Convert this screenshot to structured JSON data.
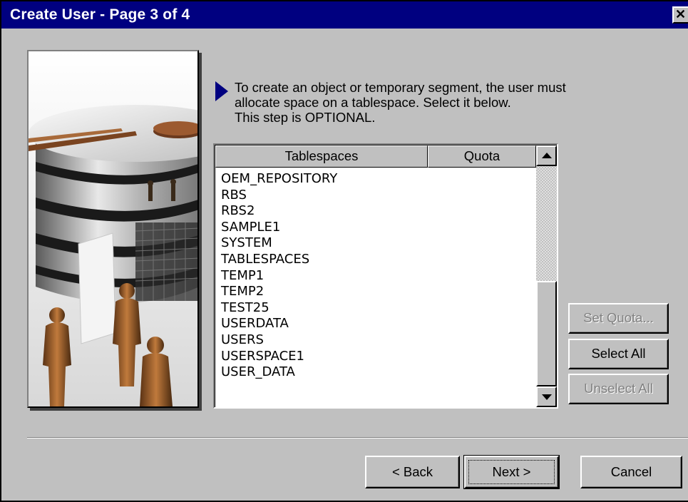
{
  "window": {
    "title": "Create User - Page 3 of 4",
    "close_glyph": "✕"
  },
  "instructions": {
    "icon": "arrow-right-icon",
    "lines": [
      "To create an object or temporary segment, the user must",
      "allocate space on a tablespace. Select it below.",
      "This step is OPTIONAL."
    ]
  },
  "table": {
    "headers": {
      "tablespaces": "Tablespaces",
      "quota": "Quota"
    },
    "rows": [
      "OEM_REPOSITORY",
      "RBS",
      "RBS2",
      "SAMPLE1",
      "SYSTEM",
      "TABLESPACES",
      "TEMP1",
      "TEMP2",
      "TEST25",
      "USERDATA",
      "USERS",
      "USERSPACE1",
      "USER_DATA"
    ]
  },
  "side_buttons": {
    "set_quota": "Set Quota...",
    "select_all": "Select All",
    "unselect_all": "Unselect All"
  },
  "nav_buttons": {
    "back": "< Back",
    "next": "Next >",
    "cancel": "Cancel"
  },
  "colors": {
    "titlebar": "#000080",
    "face": "#c0c0c0",
    "arrow": "#000080"
  }
}
